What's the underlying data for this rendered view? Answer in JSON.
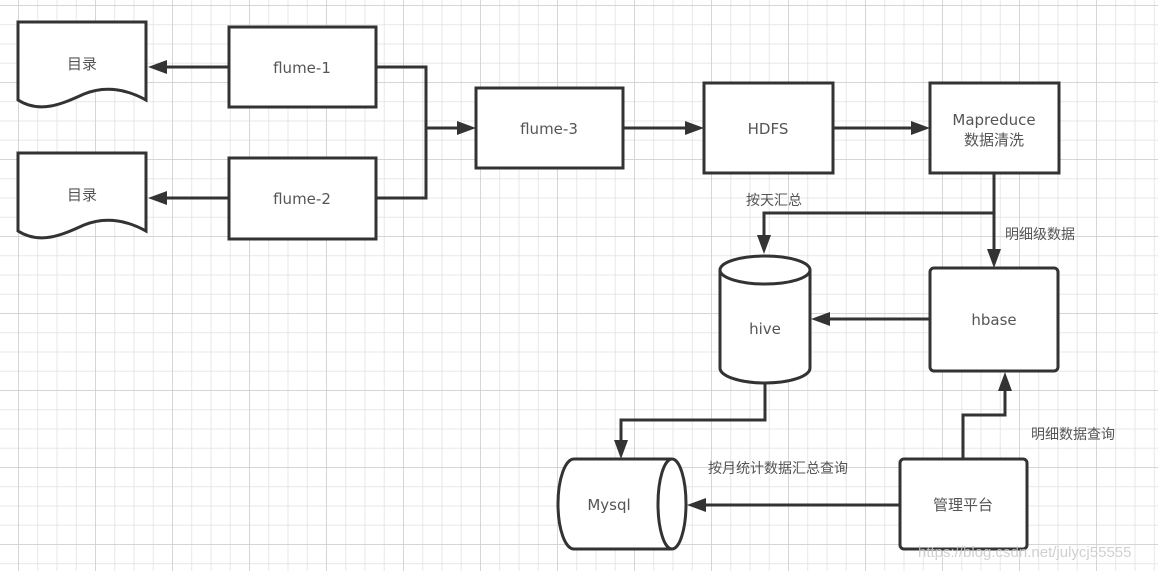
{
  "diagram": {
    "nodes": {
      "dir1": {
        "label": "目录",
        "shape": "document"
      },
      "dir2": {
        "label": "目录",
        "shape": "document"
      },
      "flume1": {
        "label": "flume-1",
        "shape": "rectangle"
      },
      "flume2": {
        "label": "flume-2",
        "shape": "rectangle"
      },
      "flume3": {
        "label": "flume-3",
        "shape": "rectangle"
      },
      "hdfs": {
        "label": "HDFS",
        "shape": "rectangle"
      },
      "mapreduce": {
        "label_line1": "Mapreduce",
        "label_line2": "数据清洗",
        "shape": "rectangle"
      },
      "hive": {
        "label": "hive",
        "shape": "cylinder"
      },
      "hbase": {
        "label": "hbase",
        "shape": "rounded-rectangle"
      },
      "mysql": {
        "label": "Mysql",
        "shape": "horizontal-cylinder"
      },
      "platform": {
        "label": "管理平台",
        "shape": "rounded-rectangle"
      }
    },
    "edges": [
      {
        "from": "flume1",
        "to": "dir1",
        "label": ""
      },
      {
        "from": "flume2",
        "to": "dir2",
        "label": ""
      },
      {
        "from": "flume1",
        "to": "flume3",
        "label": ""
      },
      {
        "from": "flume2",
        "to": "flume3",
        "label": ""
      },
      {
        "from": "flume3",
        "to": "hdfs",
        "label": ""
      },
      {
        "from": "hdfs",
        "to": "mapreduce",
        "label": ""
      },
      {
        "from": "mapreduce",
        "to": "hive",
        "label": "按天汇总"
      },
      {
        "from": "mapreduce",
        "to": "hbase",
        "label": "明细级数据"
      },
      {
        "from": "hbase",
        "to": "hive",
        "label": ""
      },
      {
        "from": "hive",
        "to": "mysql",
        "label": ""
      },
      {
        "from": "platform",
        "to": "mysql",
        "label": "按月统计数据汇总查询"
      },
      {
        "from": "platform",
        "to": "hbase",
        "label": "明细数据查询"
      }
    ],
    "labels": {
      "daily_summary": "按天汇总",
      "detail_level_data": "明细级数据",
      "detail_data_query": "明细数据查询",
      "monthly_stats_query": "按月统计数据汇总查询"
    }
  },
  "watermark": "https://blog.csdn.net/julycj55555",
  "colors": {
    "line": "#333333",
    "text": "#555555",
    "grid": "#d8d8d8",
    "background": "#ffffff"
  }
}
